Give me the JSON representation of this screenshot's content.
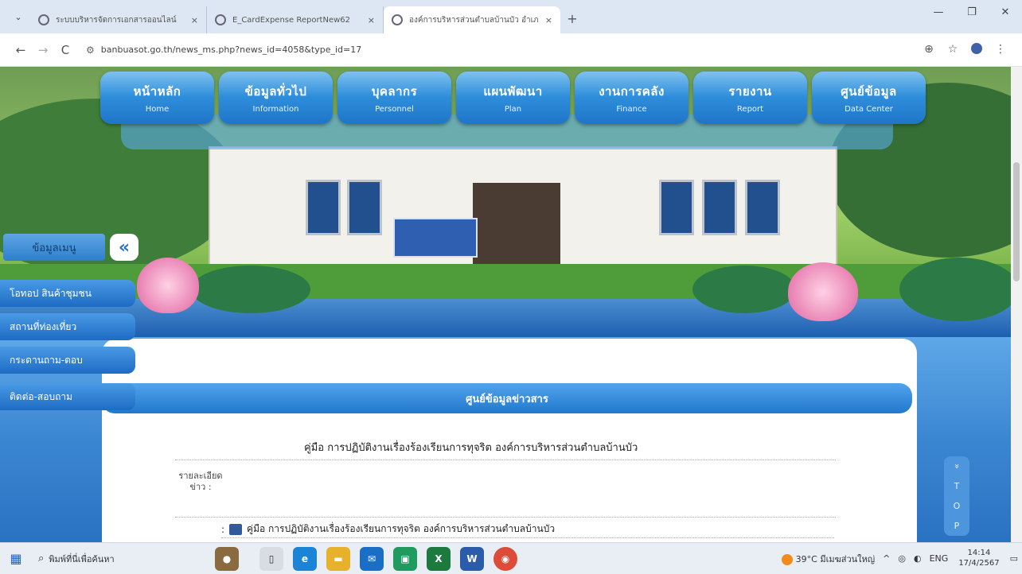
{
  "browser": {
    "tabs": [
      {
        "title": "ระบบบริหารจัดการเอกสารออนไลน์"
      },
      {
        "title": "E_CardExpense ReportNew62"
      },
      {
        "title": "องค์การบริหารส่วนตำบลบ้านบัว อำเภ"
      }
    ],
    "url": "banbuasot.go.th/news_ms.php?news_id=4058&type_id=17",
    "icons": {
      "back": "←",
      "forward": "→",
      "reload": "C",
      "zoom": "⊕",
      "star": "☆",
      "menu": "⋮",
      "close_tab": "×",
      "new_tab": "+",
      "minimize": "—",
      "maximize": "❐",
      "close": "✕"
    }
  },
  "nav": {
    "items": [
      {
        "th": "หน้าหลัก",
        "en": "Home"
      },
      {
        "th": "ข้อมูลทั่วไป",
        "en": "Information"
      },
      {
        "th": "บุคลากร",
        "en": "Personnel"
      },
      {
        "th": "แผนพัฒนา",
        "en": "Plan"
      },
      {
        "th": "งานการคลัง",
        "en": "Finance"
      },
      {
        "th": "รายงาน",
        "en": "Report"
      },
      {
        "th": "ศูนย์ข้อมูล",
        "en": "Data Center"
      }
    ]
  },
  "sidebar": {
    "header": "ข้อมูลเมนู",
    "toggle": "«",
    "items": [
      {
        "label": "โอทอป สินค้าชุมชน"
      },
      {
        "label": "สถานที่ท่องเที่ยว"
      },
      {
        "label": "กระดานถาม-ตอบ"
      },
      {
        "label": "ติดต่อ-สอบถาม"
      }
    ]
  },
  "main": {
    "section_title": "ศูนย์ข้อมูลข่าวสาร",
    "article_title": "คู่มือ การปฏิบัติงานเรื่องร้องเรียนการทุจริต องค์การบริหารส่วนตำบลบ้านบัว",
    "detail_label": "รายละเอียดข่าว :",
    "file_prefix": ":",
    "file_link": "คู่มือ การปฏิบัติงานเรื่องร้องเรียนการทุจริต องค์การบริหารส่วนตำบลบ้านบัว"
  },
  "totop": {
    "letters": [
      "T",
      "O",
      "P"
    ],
    "arrow": "»"
  },
  "taskbar": {
    "search_placeholder": "พิมพ์ที่นี่เพื่อค้นหา",
    "weather": "39°C มีเมฆส่วนใหญ่",
    "language": "ENG",
    "time": "14:14",
    "date": "17/4/2567"
  }
}
